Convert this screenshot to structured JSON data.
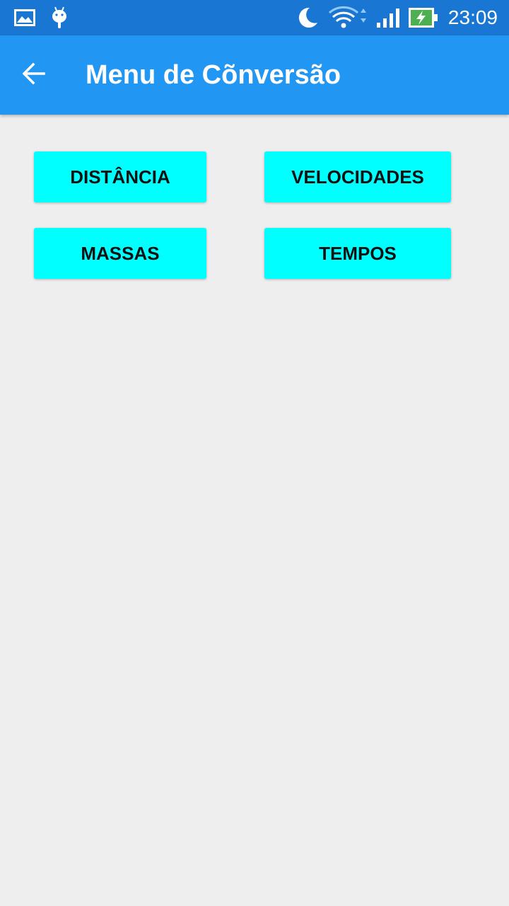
{
  "status_bar": {
    "time": "23:09",
    "icons": [
      "gallery-icon",
      "android-debug-icon",
      "do-not-disturb-moon-icon",
      "wifi-icon",
      "cell-signal-icon",
      "battery-charging-icon"
    ],
    "battery_color": "#4caf50"
  },
  "app_bar": {
    "back_icon": "arrow-back-icon",
    "title": "Menu de Cõnversão",
    "color": "#2196f3"
  },
  "menu": {
    "button_color": "#00ffff",
    "buttons": [
      {
        "label": "DISTÂNCIA"
      },
      {
        "label": "VELOCIDADES"
      },
      {
        "label": "MASSAS"
      },
      {
        "label": "TEMPOS"
      }
    ]
  }
}
